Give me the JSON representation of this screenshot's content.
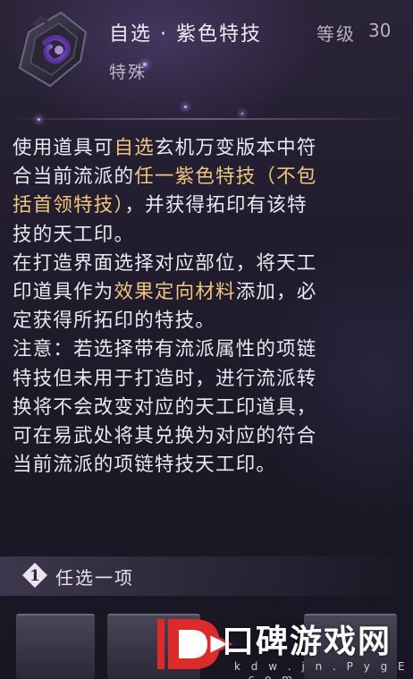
{
  "header": {
    "title": "自选 · 紫色特技",
    "level_label": "等级",
    "level_value": "30",
    "subtype": "特殊",
    "icon": "purple-seal-gem-icon"
  },
  "description": {
    "lines": [
      [
        {
          "t": "使用道具可"
        },
        {
          "t": "自选",
          "hl": true
        },
        {
          "t": "玄机万变版本中符"
        }
      ],
      [
        {
          "t": "合当前流派的"
        },
        {
          "t": "任一紫色特技（不包",
          "hl": true
        }
      ],
      [
        {
          "t": "括首领特技）",
          "hl": true
        },
        {
          "t": "，并获得拓印有该特"
        }
      ],
      [
        {
          "t": "技的天工印。"
        }
      ],
      [
        {
          "t": "在打造界面选择对应部位，将天工"
        }
      ],
      [
        {
          "t": "印道具作为"
        },
        {
          "t": "效果定向材料",
          "hl": true
        },
        {
          "t": "添加，必"
        }
      ],
      [
        {
          "t": "定获得所拓印的特技。"
        }
      ],
      [
        {
          "t": "注意：若选择带有流派属性的项链"
        }
      ],
      [
        {
          "t": "特技但未用于打造时，进行流派转"
        }
      ],
      [
        {
          "t": "换将不会改变对应的天工印道具，"
        }
      ],
      [
        {
          "t": "可在易武处将其兑换为对应的符合"
        }
      ],
      [
        {
          "t": "当前流派的项链特技天工印。"
        }
      ]
    ]
  },
  "choose": {
    "number": "1",
    "label": "任选一项"
  },
  "watermark": {
    "text": "口碑游戏网",
    "url": "k d w . j n . P y g E . c o m"
  },
  "colors": {
    "highlight": "#f0c77c",
    "text": "#ece8ef",
    "muted": "#b8b2bf"
  }
}
